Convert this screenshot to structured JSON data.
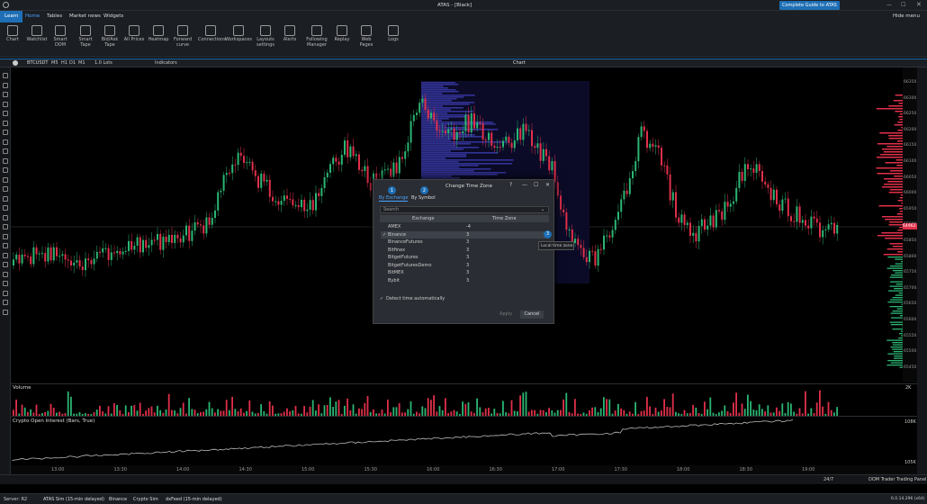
{
  "titlebar": {
    "title": "ATAS - [Black]",
    "guide_button": "Complete Guide to ATAS",
    "hide_menu": "Hide menu"
  },
  "menu": [
    "Learn",
    "Home",
    "Tables",
    "Market news",
    "Widgets"
  ],
  "ribbon": [
    {
      "label": "Chart",
      "icon": "chart-icon"
    },
    {
      "label": "Watchlist",
      "icon": "watchlist-icon"
    },
    {
      "label": "Smart DOM",
      "icon": "smart-dom-icon"
    },
    {
      "label": "Smart Tape",
      "icon": "smart-tape-icon"
    },
    {
      "label": "Bid/Ask Tape",
      "icon": "bid-ask-tape-icon"
    },
    {
      "label": "All Prices",
      "icon": "all-prices-icon"
    },
    {
      "label": "Heatmap",
      "icon": "heatmap-icon"
    },
    {
      "label": "Forward curve",
      "icon": "forward-curve-icon"
    },
    {
      "label": "Connections",
      "icon": "connections-icon"
    },
    {
      "label": "Workspaces",
      "icon": "workspaces-icon"
    },
    {
      "label": "Layouts settings",
      "icon": "layouts-icon"
    },
    {
      "label": "Alerts",
      "icon": "alerts-icon"
    },
    {
      "label": "Following Manager",
      "icon": "following-icon"
    },
    {
      "label": "Replay",
      "icon": "replay-icon"
    },
    {
      "label": "Web Pages",
      "icon": "web-pages-icon"
    },
    {
      "label": "Logs",
      "icon": "logs-icon"
    }
  ],
  "chartbar": {
    "symbol": "BTCUSDT",
    "timeframes": [
      "M5",
      "H1",
      "D1",
      "M1"
    ],
    "lots": "1.0 Lots",
    "indicators": "Indicators",
    "title": "Chart"
  },
  "price_ticks": [
    "66350.0",
    "66300.0",
    "66250.0",
    "66200.0",
    "66150.0",
    "66100.0",
    "66050.0",
    "66000.0",
    "65950.0",
    "65900.0",
    "65850.0",
    "65800.0",
    "65750.0",
    "65700.0",
    "65650.0",
    "65600.0",
    "65550.0",
    "65500.0",
    "65450.0"
  ],
  "current_price": "64962.5",
  "volume_label": "Volume",
  "volume_axis": "2K",
  "oi_label": "Crypto Open Interest (Bars, True)",
  "oi_axis": [
    "108K",
    "105K"
  ],
  "time_ticks": [
    "13:00",
    "13:30",
    "14:00",
    "14:30",
    "15:00",
    "15:30",
    "16:00",
    "16:30",
    "17:00",
    "17:30",
    "18:00",
    "18:30",
    "19:00"
  ],
  "bottom_bar": {
    "tz": "24/7",
    "dom_trader": "DOM Trader",
    "trading_panel": "Trading Panel"
  },
  "status": {
    "server": "Server: R2",
    "items": [
      "ATAS Sim (15-min delayed)",
      "Binance",
      "Crypto Sim",
      "dxFeed (15-min delayed)"
    ],
    "version": "6.0.14.296 (x64)"
  },
  "dialog": {
    "title": "Change Time Zone",
    "tab1": "By Exchange",
    "tab2": "By Symbol",
    "step1": "1",
    "step2": "2",
    "step3": "3",
    "search_placeholder": "Search",
    "col_exchange": "Exchange",
    "col_tz": "Time Zone",
    "rows": [
      {
        "exchange": "AMEX",
        "tz": "-4",
        "checked": ""
      },
      {
        "exchange": "Binance",
        "tz": "3",
        "checked": "✓"
      },
      {
        "exchange": "BinanceFutures",
        "tz": "3",
        "checked": ""
      },
      {
        "exchange": "Bitfinex",
        "tz": "3",
        "checked": ""
      },
      {
        "exchange": "BitgetFutures",
        "tz": "3",
        "checked": ""
      },
      {
        "exchange": "BitgetFuturesDemo",
        "tz": "3",
        "checked": ""
      },
      {
        "exchange": "BitMEX",
        "tz": "3",
        "checked": ""
      },
      {
        "exchange": "Bybit",
        "tz": "3",
        "checked": ""
      }
    ],
    "tooltip": "Local time zone",
    "detect": "Detect time automatically",
    "apply": "Apply",
    "cancel": "Cancel"
  },
  "colors": {
    "up": "#2bb673",
    "down": "#e0304a",
    "accent": "#1e6fb5",
    "profile": "#3a3aa8"
  }
}
